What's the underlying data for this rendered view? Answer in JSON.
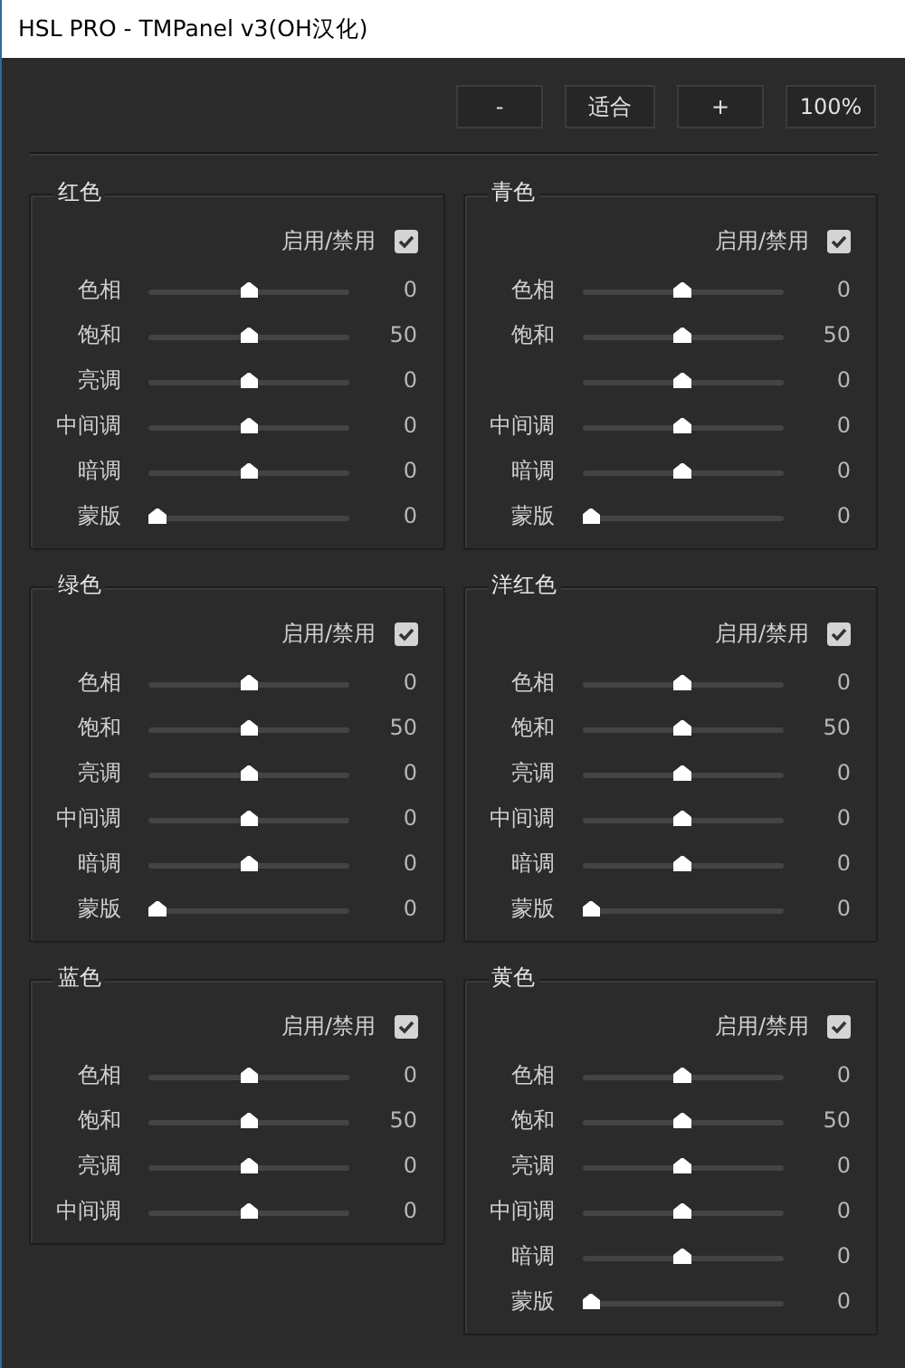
{
  "window": {
    "title": "HSL PRO - TMPanel v3(OH汉化)"
  },
  "toolbar": [
    "-",
    "适合",
    "+",
    "100%"
  ],
  "panels": [
    {
      "title": "红色",
      "toggle": {
        "label": "启用/禁用",
        "checked": true
      },
      "rows": [
        {
          "label": "色相",
          "level": 0.5,
          "reading": "0"
        },
        {
          "label": "饱和",
          "level": 0.5,
          "reading": "50"
        },
        {
          "label": "亮调",
          "level": 0.5,
          "reading": "0"
        },
        {
          "label": "中间调",
          "level": 0.5,
          "reading": "0"
        },
        {
          "label": "暗调",
          "level": 0.5,
          "reading": "0"
        },
        {
          "label": "蒙版",
          "level": 0,
          "reading": "0"
        }
      ]
    },
    {
      "title": "青色",
      "toggle": {
        "label": "启用/禁用",
        "checked": true
      },
      "rows": [
        {
          "label": "色相",
          "level": 0.5,
          "reading": "0"
        },
        {
          "label": "饱和",
          "level": 0.5,
          "reading": "50"
        },
        {
          "level": 0.5,
          "reading": "0"
        },
        {
          "label": "中间调",
          "level": 0.5,
          "reading": "0"
        },
        {
          "label": "暗调",
          "level": 0.5,
          "reading": "0"
        },
        {
          "label": "蒙版",
          "level": 0,
          "reading": "0"
        }
      ]
    },
    {
      "title": "绿色",
      "toggle": {
        "label": "启用/禁用",
        "checked": true
      },
      "rows": [
        {
          "label": "色相",
          "level": 0.5,
          "reading": "0"
        },
        {
          "label": "饱和",
          "level": 0.5,
          "reading": "50"
        },
        {
          "label": "亮调",
          "level": 0.5,
          "reading": "0"
        },
        {
          "label": "中间调",
          "level": 0.5,
          "reading": "0"
        },
        {
          "label": "暗调",
          "level": 0.5,
          "reading": "0"
        },
        {
          "label": "蒙版",
          "level": 0,
          "reading": "0"
        }
      ]
    },
    {
      "title": "洋红色",
      "toggle": {
        "label": "启用/禁用",
        "checked": true
      },
      "rows": [
        {
          "label": "色相",
          "level": 0.5,
          "reading": "0"
        },
        {
          "label": "饱和",
          "level": 0.5,
          "reading": "50"
        },
        {
          "label": "亮调",
          "level": 0.5,
          "reading": "0"
        },
        {
          "label": "中间调",
          "level": 0.5,
          "reading": "0"
        },
        {
          "label": "暗调",
          "level": 0.5,
          "reading": "0"
        },
        {
          "label": "蒙版",
          "level": 0,
          "reading": "0"
        }
      ]
    },
    {
      "title": "蓝色",
      "toggle": {
        "label": "启用/禁用",
        "checked": true
      },
      "rows": [
        {
          "label": "色相",
          "level": 0.5,
          "reading": "0"
        },
        {
          "label": "饱和",
          "level": 0.5,
          "reading": "50"
        },
        {
          "label": "亮调",
          "level": 0.5,
          "reading": "0"
        },
        {
          "label": "中间调",
          "level": 0.5,
          "reading": "0"
        }
      ]
    },
    {
      "title": "黄色",
      "toggle": {
        "label": "启用/禁用",
        "checked": true
      },
      "rows": [
        {
          "label": "色相",
          "level": 0.5,
          "reading": "0"
        },
        {
          "label": "饱和",
          "level": 0.5,
          "reading": "50"
        },
        {
          "label": "亮调",
          "level": 0.5,
          "reading": "0"
        },
        {
          "label": "中间调",
          "level": 0.5,
          "reading": "0"
        },
        {
          "label": "暗调",
          "level": 0.5,
          "reading": "0"
        },
        {
          "label": "蒙版",
          "level": 0,
          "reading": "0"
        }
      ]
    }
  ]
}
